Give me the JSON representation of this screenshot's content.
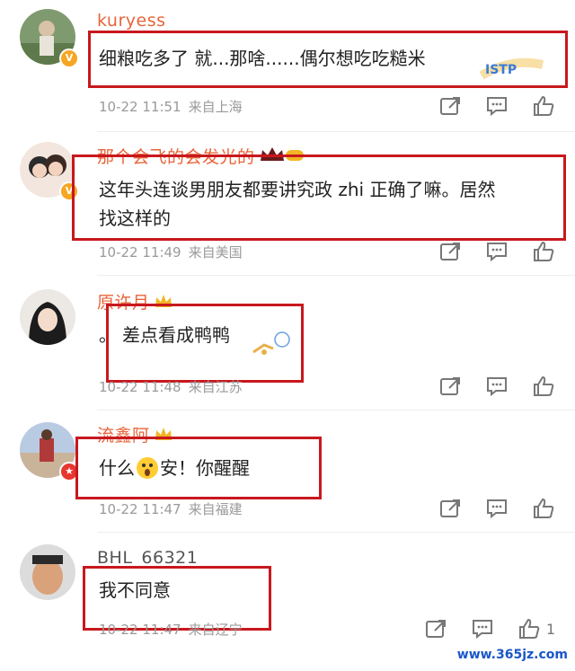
{
  "comments": [
    {
      "username": "kuryess",
      "text": "细粮吃多了 就...那啥......偶尔想吃吃糙米",
      "time": "10-22 11:51",
      "location": "来自上海",
      "sticker": "ISTP"
    },
    {
      "username": "那个会飞的会发光的",
      "text_line1": "这年头连谈男朋友都要讲究政 zhi 正确了嘛。居然",
      "text_line2": "找这样的",
      "time": "10-22 11:49",
      "location": "来自美国"
    },
    {
      "username": "原许月",
      "text": "差点看成鸭鸭",
      "text_prefix": "。",
      "time": "10-22 11:48",
      "location": "来自江苏"
    },
    {
      "username": "流鑫阿",
      "text_before": "什么",
      "text_after": "安！你醒醒",
      "time": "10-22 11:47",
      "location": "来自福建"
    },
    {
      "username": "BHL_66321",
      "text": "我不同意",
      "time": "10-22 11:47",
      "location": "来自辽宁",
      "like_count": "1"
    }
  ],
  "watermark": "www.365jz.com",
  "colors": {
    "highlight_box": "#c8181e",
    "vip_name": "#e8643a",
    "meta": "#9a9a9a"
  },
  "icons": [
    "share-icon",
    "comment-icon",
    "like-icon"
  ]
}
